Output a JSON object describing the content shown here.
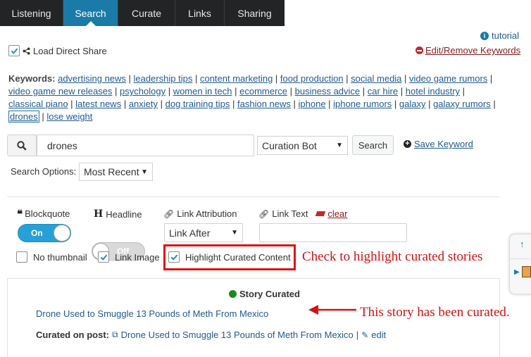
{
  "tabs": [
    {
      "label": "Listening",
      "active": false
    },
    {
      "label": "Search",
      "active": true
    },
    {
      "label": "Curate",
      "active": false
    },
    {
      "label": "Links",
      "active": false
    },
    {
      "label": "Sharing",
      "active": false
    }
  ],
  "tutorial_link": "tutorial",
  "load_direct_share": {
    "label": "Load Direct Share",
    "checked": true
  },
  "edit_remove_keywords": "Edit/Remove Keywords",
  "keywords": {
    "label": "Keywords:",
    "items": [
      "advertising news",
      "leadership tips",
      "content marketing",
      "food production",
      "social media",
      "video game rumors",
      "video game new releases",
      "psychology",
      "women in tech",
      "ecommerce",
      "business advice",
      "car hire",
      "hotel industry",
      "classical piano",
      "latest news",
      "anxiety",
      "dog training tips",
      "fashion news",
      "iphone",
      "iphone rumors",
      "galaxy",
      "galaxy rumors",
      "drones",
      "lose weight"
    ],
    "selected": "drones"
  },
  "search": {
    "value": "drones",
    "source_select": "Curation Bot",
    "button": "Search",
    "save_keyword": "Save Keyword"
  },
  "search_options": {
    "label": "Search Options:",
    "value": "Most Recent"
  },
  "options": {
    "blockquote": {
      "label": "Blockquote",
      "state": "On"
    },
    "headline": {
      "label": "Headline",
      "state": "Off"
    },
    "link_attribution": {
      "label": "Link Attribution",
      "value": "Link After"
    },
    "link_text": {
      "label": "Link Text",
      "clear": "clear",
      "value": ""
    }
  },
  "checks": {
    "no_thumbnail": {
      "label": "No thumbnail",
      "checked": false
    },
    "link_image": {
      "label": "Link Image",
      "checked": true
    },
    "highlight": {
      "label": "Highlight Curated Content",
      "checked": true
    }
  },
  "annotations": {
    "highlight_note": "Check to highlight curated stories",
    "story_note": "This story has been curated."
  },
  "result": {
    "status": "Story Curated",
    "status_color": "#1a8a1a",
    "title": "Drone Used to Smuggle 13 Pounds of Meth From Mexico",
    "curated_label": "Curated on post:",
    "post_title": "Drone Used to Smuggle 13 Pounds of Meth From Mexico",
    "edit": "edit"
  },
  "colors": {
    "accent": "#1a7aa8",
    "toggle_on": "#27a0d8",
    "annotation": "#d21414"
  }
}
